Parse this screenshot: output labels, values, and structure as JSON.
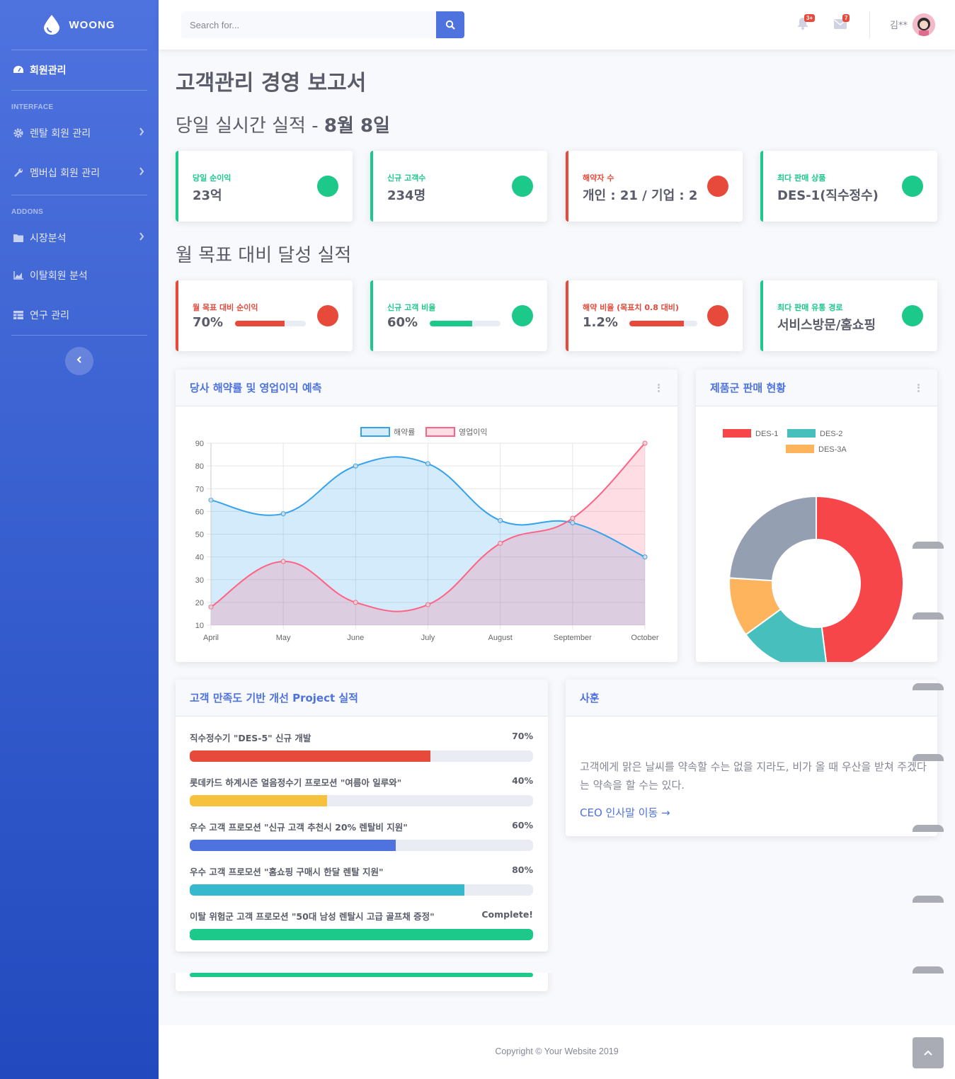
{
  "brand": {
    "name": "WOONG"
  },
  "sidebar": {
    "dashboard_label": "회원관리",
    "heading_interface": "INTERFACE",
    "heading_addons": "ADDONS",
    "items": [
      {
        "label": "렌탈 회원 관리",
        "icon": "gear-icon"
      },
      {
        "label": "멤버십 회원 관리",
        "icon": "wrench-icon"
      },
      {
        "label": "시장분석",
        "icon": "folder-icon"
      },
      {
        "label": "이탈회원 분석",
        "icon": "area-chart-icon"
      },
      {
        "label": "연구 관리",
        "icon": "table-icon"
      }
    ]
  },
  "topbar": {
    "search_placeholder": "Search for...",
    "alerts_badge": "3+",
    "messages_badge": "7",
    "username": "김**"
  },
  "page": {
    "title": "고객관리 경영 보고서",
    "daily_heading": "당일 실시간 실적 - ",
    "daily_date": "8월 8일",
    "monthly_heading": "월 목표 대비 달성 실적"
  },
  "daily_cards": [
    {
      "label": "당일 순이익",
      "value": "23억",
      "status": "green"
    },
    {
      "label": "신규 고객수",
      "value": "234명",
      "status": "green"
    },
    {
      "label": "해약자 수",
      "value": "개인 : 21 / 기업 : 2",
      "status": "red"
    },
    {
      "label": "최다 판매 상품",
      "value": "DES-1(직수정수)",
      "status": "green"
    }
  ],
  "monthly_cards": [
    {
      "label": "월 목표 대비 순이익",
      "value": "70%",
      "progress": 70,
      "status": "red"
    },
    {
      "label": "신규 고객 비율",
      "value": "60%",
      "progress": 60,
      "status": "green"
    },
    {
      "label": "해약 비율 (목표치 0.8 대비)",
      "value": "1.2%",
      "progress": 80,
      "status": "red"
    },
    {
      "label": "최다 판매 유통 경로",
      "value": "서비스방문/홈쇼핑",
      "status": "green"
    }
  ],
  "colors": {
    "primary": "#4e73df",
    "success": "#1cc88a",
    "danger": "#e74a3b",
    "warning": "#f6c23e",
    "info": "#36b9cc"
  },
  "area_panel": {
    "title": "당사 해약률 및 영업이익 예측"
  },
  "donut_panel": {
    "title": "제품군 판매 현황"
  },
  "chart_data": [
    {
      "type": "line",
      "categories": [
        "April",
        "May",
        "June",
        "July",
        "August",
        "September",
        "October"
      ],
      "series": [
        {
          "name": "해약률",
          "values": [
            65,
            59,
            80,
            81,
            56,
            55,
            40
          ],
          "color": "#36a2eb"
        },
        {
          "name": "영업이익",
          "values": [
            18,
            38,
            20,
            19,
            46,
            57,
            90
          ],
          "color": "#ff6384"
        }
      ],
      "ylim": [
        10,
        90
      ],
      "yticks": [
        10,
        20,
        30,
        40,
        50,
        60,
        70,
        80,
        90
      ],
      "legend": "top",
      "grid": true,
      "fill": true
    },
    {
      "type": "pie",
      "donut": true,
      "labels": [
        "DES-1",
        "DES-2",
        "DES-3A",
        ""
      ],
      "values": [
        48,
        17,
        11,
        24
      ],
      "colors": [
        "#f7464a",
        "#46bfbd",
        "#fdb45c",
        "#949fb1"
      ],
      "legend": "top"
    }
  ],
  "projects_panel": {
    "title": "고객 만족도 기반 개선 Project 실적",
    "items": [
      {
        "name": "직수정수기 \"DES-5\" 신규 개발",
        "pct_label": "70%",
        "progress": 70,
        "color": "#e74a3b"
      },
      {
        "name": "롯데카드 하계시즌 얼음정수기 프로모션 \"여름아 일루와\"",
        "pct_label": "40%",
        "progress": 40,
        "color": "#f6c23e"
      },
      {
        "name": "우수 고객 프로모션 \"신규 고객 추천시 20% 렌탈비 지원\"",
        "pct_label": "60%",
        "progress": 60,
        "color": "#4e73df"
      },
      {
        "name": "우수 고객 프로모션 \"홈쇼핑 구매시 한달 렌탈 지원\"",
        "pct_label": "80%",
        "progress": 80,
        "color": "#36b9cc"
      },
      {
        "name": "이탈 위험군 고객 프로모션 \"50대 남성 렌탈시 고급 골프채 증정\"",
        "pct_label": "Complete!",
        "progress": 100,
        "color": "#1cc88a"
      }
    ]
  },
  "motto_panel": {
    "title": "사훈",
    "quote": "고객에게 맑은 날씨를 약속할 수는 없을 지라도, 비가 올 때 우산을 받쳐 주겠다는 약속을 할 수는 있다.",
    "link": "CEO 인사말 이동 →"
  },
  "footer": {
    "copyright": "Copyright © Your Website 2019"
  }
}
